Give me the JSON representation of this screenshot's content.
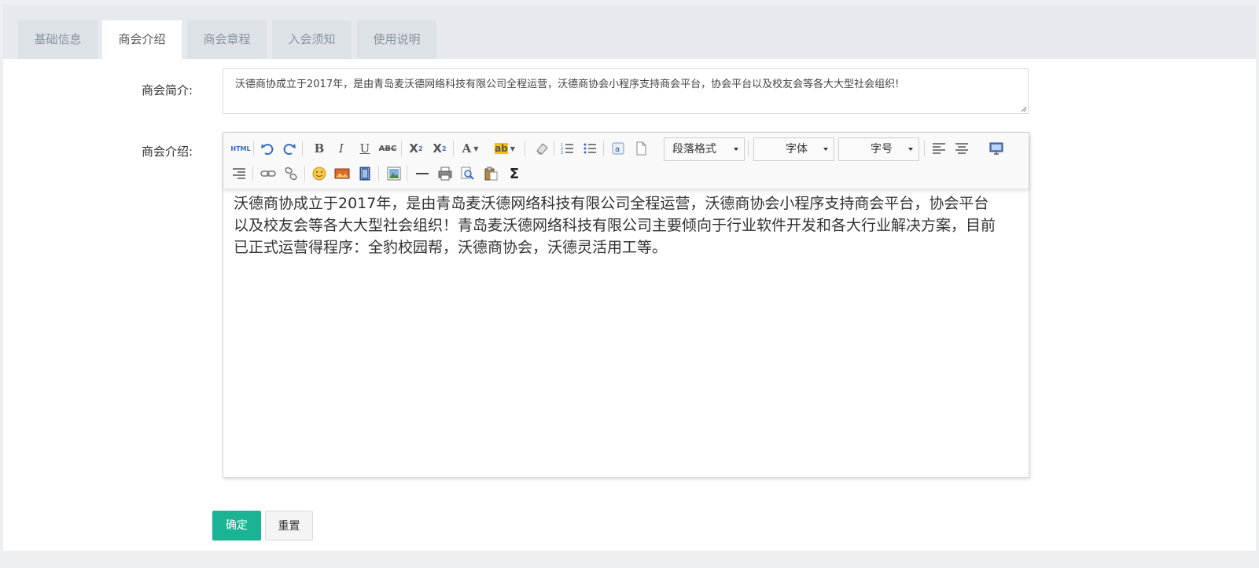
{
  "tabs": [
    {
      "label": "基础信息",
      "active": false
    },
    {
      "label": "商会介绍",
      "active": true
    },
    {
      "label": "商会章程",
      "active": false
    },
    {
      "label": "入会须知",
      "active": false
    },
    {
      "label": "使用说明",
      "active": false
    }
  ],
  "form": {
    "summary_label": "商会简介:",
    "summary_value": "沃德商协成立于2017年，是由青岛麦沃德网络科技有限公司全程运营，沃德商协会小程序支持商会平台，协会平台以及校友会等各大大型社会组织!",
    "intro_label": "商会介绍:"
  },
  "editor": {
    "html_label": "HTML",
    "paragraph_format": "段落格式",
    "font_family": "字体",
    "font_size": "字号",
    "content": "沃德商协成立于2017年，是由青岛麦沃德网络科技有限公司全程运营，沃德商协会小程序支持商会平台，协会平台以及校友会等各大大型社会组织！青岛麦沃德网络科技有限公司主要倾向于行业软件开发和各大行业解决方案，目前已正式运营得程序：全豹校园帮，沃德商协会，沃德灵活用工等。"
  },
  "actions": {
    "confirm_label": "确定",
    "reset_label": "重置"
  },
  "colors": {
    "primary": "#1ab394",
    "tab_bar": "#e6eaee",
    "page_bg": "#edf0f3"
  }
}
